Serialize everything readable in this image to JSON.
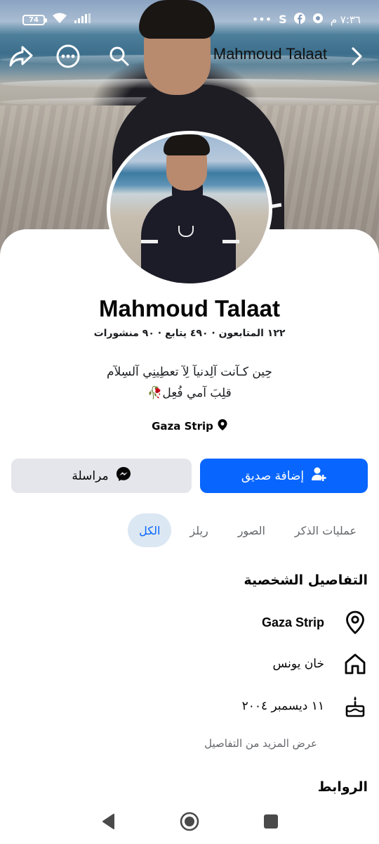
{
  "status_bar": {
    "time": "٧:٣٦ م",
    "battery": "74",
    "notification_icons": [
      "threads-icon",
      "facebook-icon",
      "s-icon",
      "more-dots-icon"
    ]
  },
  "header": {
    "title": "Mahmoud Talaat",
    "back_icon": "chevron-right-icon",
    "search_icon": "search-icon",
    "more_icon": "more-options-icon",
    "share_icon": "share-icon"
  },
  "profile": {
    "name": "Mahmoud Talaat",
    "stats": "١٢٢ المتابعون · ٤٩٠ يتابع · ٩٠ منشورات",
    "bio_line1": "حِين كـآنت آلِدنيآ لِآ تعطِينِي آلسِلآم",
    "bio_line2": "قلِبَ آمي فُعِل🥀",
    "location": "Gaza Strip"
  },
  "actions": {
    "add_friend": "إضافة صديق",
    "message": "مراسلة"
  },
  "tabs": [
    {
      "label": "الكل",
      "active": true
    },
    {
      "label": "ريلز",
      "active": false
    },
    {
      "label": "الصور",
      "active": false
    },
    {
      "label": "عمليات الذكر",
      "active": false
    }
  ],
  "details": {
    "title": "التفاصيل الشخصية",
    "location": "Gaza Strip",
    "hometown": "خان يونس",
    "birthday": "١١ ديسمبر ٢٠٠٤",
    "see_more": "عرض المزيد من التفاصيل"
  },
  "links": {
    "title": "الروابط"
  },
  "colors": {
    "primary": "#0866ff",
    "secondary_button": "#e4e6eb",
    "active_tab_bg": "#dbe7f2",
    "muted_text": "#65676b"
  }
}
